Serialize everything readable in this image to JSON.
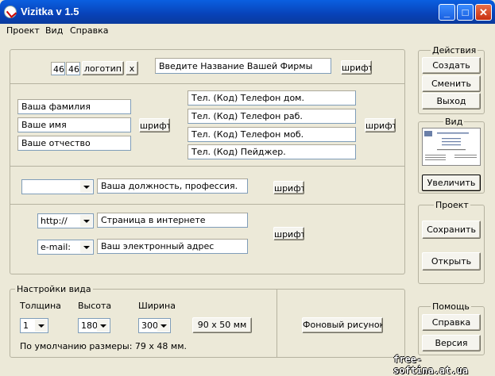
{
  "window": {
    "title": "Vizitka v 1.5",
    "minimize": "_",
    "maximize": "□",
    "close": "✕"
  },
  "menu": [
    "Проект",
    "Вид",
    "Справка"
  ],
  "company": {
    "num1": "46",
    "num2": "46",
    "logo_button": "логотип",
    "x_button": "x",
    "name_field": "Введите Название Вашей Фирмы",
    "font_button": "шрифт"
  },
  "person": {
    "last_name": "Ваша фамилия",
    "first_name": "Ваше имя",
    "patronymic": "Ваше отчество",
    "font_button": "шрифт"
  },
  "phones": {
    "home": "Тел. (Код) Телефон дом.",
    "work": "Тел. (Код) Телефон раб.",
    "mobile": "Тел. (Код) Телефон моб.",
    "pager": "Тел. (Код) Пейджер.",
    "font_button": "шрифт"
  },
  "position": {
    "combo_value": "",
    "field": "Ваша должность, профессия.",
    "font_button": "шрифт"
  },
  "internet": {
    "url_combo": "http://",
    "url_field": "Страница в интернете",
    "email_combo": "e-mail:",
    "email_field": "Ваш электронный адрес",
    "font_button": "шрифт"
  },
  "view_settings": {
    "group_label": "Настройки вида",
    "thickness_label": "Толщина",
    "thickness_value": "1",
    "height_label": "Высота",
    "height_value": "180",
    "width_label": "Ширина",
    "width_value": "300",
    "size_button": "90 x 50 мм",
    "default_note": "По умолчанию размеры: 79 x 48 мм.",
    "background_button": "Фоновый рисунок"
  },
  "actions": {
    "group_label": "Действия",
    "create": "Создать",
    "change": "Сменить",
    "exit": "Выход"
  },
  "view": {
    "group_label": "Вид",
    "zoom_button": "Увеличить"
  },
  "project": {
    "group_label": "Проект",
    "save": "Сохранить",
    "open": "Открыть"
  },
  "help": {
    "group_label": "Помощь",
    "help_button": "Справка",
    "version_button": "Версия"
  },
  "watermark": "free-softina.at.ua"
}
